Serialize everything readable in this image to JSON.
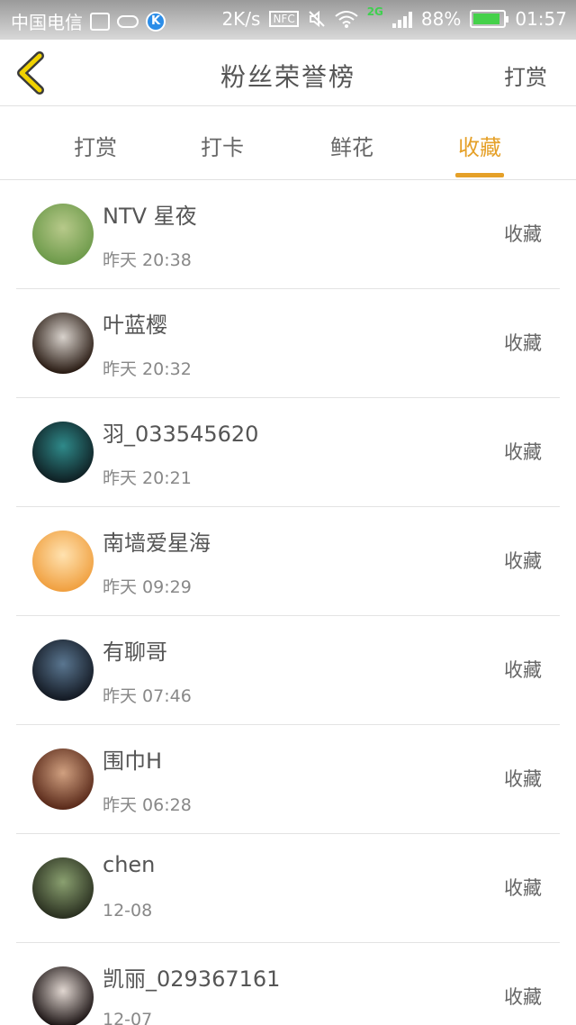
{
  "status_bar": {
    "carrier": "中国电信",
    "speed": "2K/s",
    "nfc": "NFC",
    "network": "2G",
    "battery": "88%",
    "time": "01:57",
    "battery_level": 0.88
  },
  "header": {
    "title": "粉丝荣誉榜",
    "right_action": "打赏"
  },
  "tabs": [
    {
      "label": "打赏"
    },
    {
      "label": "打卡"
    },
    {
      "label": "鲜花"
    },
    {
      "label": "收藏"
    }
  ],
  "active_tab": 3,
  "colors": {
    "accent": "#e5a028",
    "back_arrow": "#f0d200"
  },
  "list": [
    {
      "name": "NTV 星夜",
      "time": "昨天 20:38",
      "action": "收藏",
      "avatar": {
        "c1": "#6d9a4a",
        "c2": "#b7c98a"
      }
    },
    {
      "name": "叶蓝樱",
      "time": "昨天 20:32",
      "action": "收藏",
      "avatar": {
        "c1": "#2a1c14",
        "c2": "#d8d2cc"
      }
    },
    {
      "name": "羽_033545620",
      "time": "昨天 20:21",
      "action": "收藏",
      "avatar": {
        "c1": "#0f2024",
        "c2": "#2f8a8a"
      }
    },
    {
      "name": "南墙爱星海",
      "time": "昨天 09:29",
      "action": "收藏",
      "avatar": {
        "c1": "#f0a040",
        "c2": "#ffe2b0"
      }
    },
    {
      "name": "有聊哥",
      "time": "昨天 07:46",
      "action": "收藏",
      "avatar": {
        "c1": "#141a24",
        "c2": "#5a7690"
      }
    },
    {
      "name": "围巾H",
      "time": "昨天 06:28",
      "action": "收藏",
      "avatar": {
        "c1": "#5a2a1a",
        "c2": "#d0a080"
      }
    },
    {
      "name": "chen",
      "time": "12-08",
      "action": "收藏",
      "avatar": {
        "c1": "#2a3020",
        "c2": "#8aa070"
      }
    },
    {
      "name": "凯丽_029367161",
      "time": "12-07",
      "action": "收藏",
      "avatar": {
        "c1": "#1c1414",
        "c2": "#e0d6d0"
      }
    }
  ]
}
